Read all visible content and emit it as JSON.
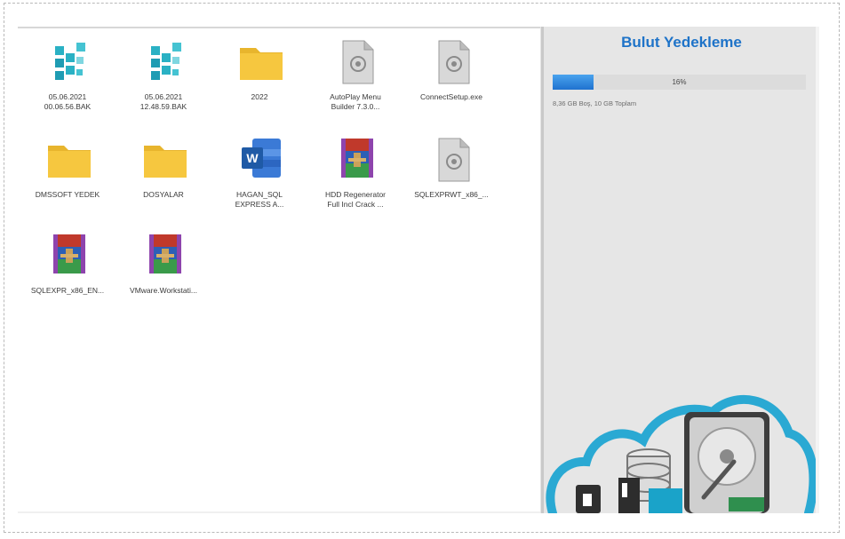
{
  "cloud_backup": {
    "title": "Bulut Yedekleme",
    "progress_percent": 16,
    "progress_text": "16%",
    "storage_text": "8,36 GB Boş, 10 GB Toplam"
  },
  "files": [
    {
      "name": "05.06.2021\n00.06.56.BAK",
      "icon": "backup-file-icon"
    },
    {
      "name": "05.06.2021\n12.48.59.BAK",
      "icon": "backup-file-icon"
    },
    {
      "name": "2022",
      "icon": "folder-icon"
    },
    {
      "name": "AutoPlay Menu\nBuilder 7.3.0...",
      "icon": "generic-file-icon"
    },
    {
      "name": "ConnectSetup.exe",
      "icon": "generic-file-icon"
    },
    {
      "name": "DMSSOFT YEDEK",
      "icon": "folder-icon"
    },
    {
      "name": "DOSYALAR",
      "icon": "folder-icon"
    },
    {
      "name": "HAGAN_SQL\nEXPRESS A...",
      "icon": "word-document-icon"
    },
    {
      "name": "HDD Regenerator\nFull Incl Crack ...",
      "icon": "winrar-archive-icon"
    },
    {
      "name": "SQLEXPRWT_x86_...",
      "icon": "generic-file-icon"
    },
    {
      "name": "SQLEXPR_x86_EN...",
      "icon": "winrar-archive-icon"
    },
    {
      "name": "VMware.Workstati...",
      "icon": "winrar-archive-icon"
    }
  ],
  "colors": {
    "accent": "#1e73c8",
    "folder": "#f6c73f",
    "backup_icon": "#2ab1c4",
    "word_blue": "#1f5aa6",
    "cloud": "#2aa9d3"
  }
}
